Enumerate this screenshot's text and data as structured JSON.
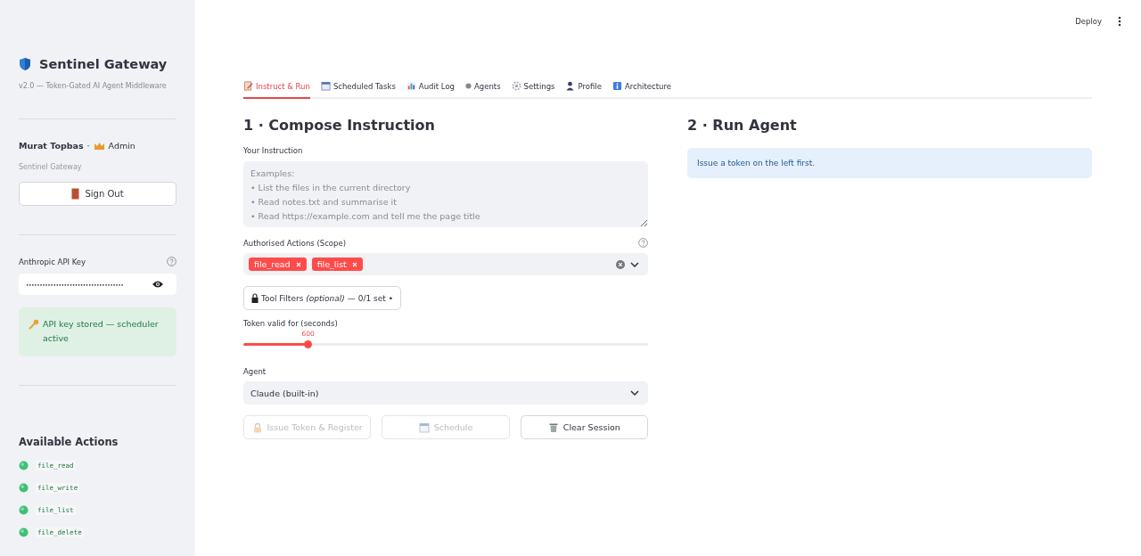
{
  "sidebar": {
    "title": "Sentinel Gateway",
    "subtitle": "v2.0 — Token-Gated AI Agent Middleware",
    "user": {
      "name": "Murat Topbas",
      "separator": "·",
      "role": "Admin"
    },
    "org": "Sentinel Gateway",
    "sign_out": "Sign Out",
    "api_key": {
      "label": "Anthropic API Key",
      "value": "••••••••••••••••••••••••••••••••••••"
    },
    "notice": "API key stored — scheduler active",
    "actions_title": "Available Actions",
    "actions": [
      "file_read",
      "file_write",
      "file_list",
      "file_delete"
    ]
  },
  "header": {
    "deploy": "Deploy"
  },
  "tabs": [
    {
      "label": "Instruct & Run",
      "kind": "memo",
      "selected": true
    },
    {
      "label": "Scheduled Tasks",
      "kind": "calendar",
      "selected": false
    },
    {
      "label": "Audit Log",
      "kind": "chart",
      "selected": false
    },
    {
      "label": "Agents",
      "kind": "dot",
      "selected": false
    },
    {
      "label": "Settings",
      "kind": "gear",
      "selected": false
    },
    {
      "label": "Profile",
      "kind": "person",
      "selected": false
    },
    {
      "label": "Architecture",
      "kind": "info",
      "selected": false
    }
  ],
  "compose": {
    "title": "1 · Compose Instruction",
    "instruction_label": "Your Instruction",
    "placeholder": "Examples:\n• List the files in the current directory\n• Read notes.txt and summarise it\n• Read https://example.com and tell me the page title",
    "scope_label": "Authorised Actions (Scope)",
    "scope": [
      "file_read",
      "file_list"
    ],
    "tool_filters": "Tool Filters *(optional)* — 0/1 set •",
    "token_label": "Token valid for (seconds)",
    "token": {
      "reading": "600",
      "level": 0.16
    },
    "agent_label": "Agent",
    "agent": "Claude (built-in)",
    "buttons": [
      {
        "label": "Issue Token & Register",
        "kind": "lock",
        "disabled": true
      },
      {
        "label": "Schedule",
        "kind": "calendar",
        "disabled": true
      },
      {
        "label": "Clear Session",
        "kind": "trash",
        "disabled": false
      }
    ]
  },
  "run": {
    "title": "2 · Run Agent",
    "info": "Issue a token on the left first."
  }
}
